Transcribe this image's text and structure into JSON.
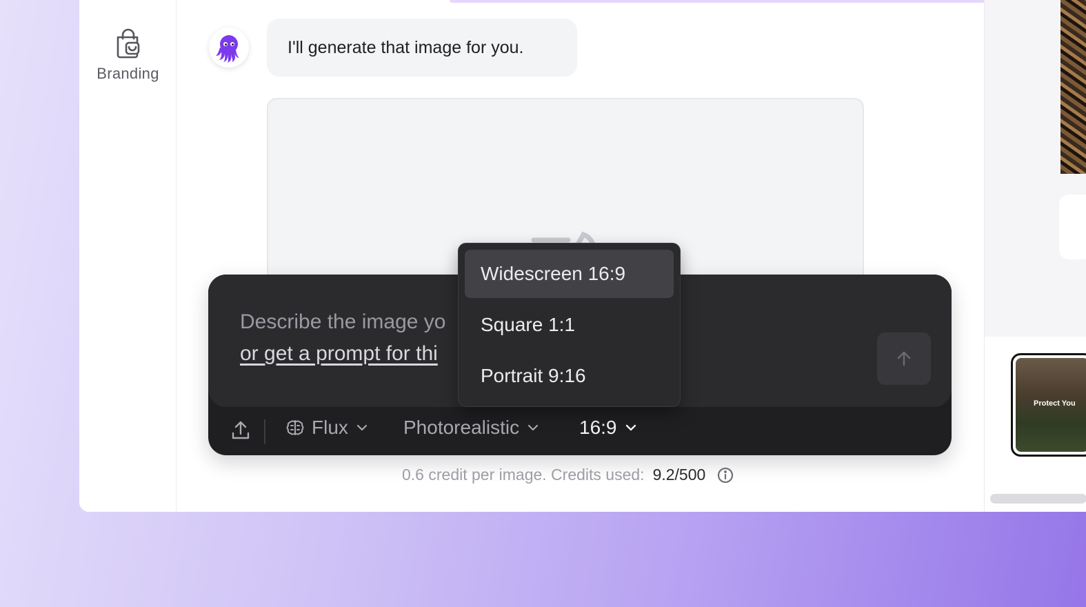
{
  "sidebar": {
    "items": [
      {
        "label": "Branding",
        "icon": "shopping-bag-icon"
      }
    ]
  },
  "chat": {
    "assistant_avatar": "octopus-avatar",
    "message": "I'll generate that image for you.",
    "image_placeholder_icon": "image-loading-icon"
  },
  "composer": {
    "placeholder": "Describe the image yo",
    "prompt_link": "or get a prompt for thi",
    "send_icon": "arrow-up-icon",
    "toolbar": {
      "upload_icon": "upload-icon",
      "model_icon": "brain-icon",
      "model": "Flux",
      "style": "Photorealistic",
      "aspect_ratio": "16:9"
    }
  },
  "aspect_dropdown": {
    "options": [
      {
        "label": "Widescreen 16:9",
        "selected": true
      },
      {
        "label": "Square 1:1",
        "selected": false
      },
      {
        "label": "Portrait 9:16",
        "selected": false
      }
    ]
  },
  "credits": {
    "text": "0.6 credit per image. Credits used:",
    "used": "9.2/500",
    "info_icon": "info-icon"
  },
  "right_panel": {
    "thumbnail_caption": "Protect You"
  },
  "colors": {
    "accent_purple": "#8b5cf6",
    "composer_bg": "#1f1f22",
    "dropdown_active": "#424246"
  }
}
